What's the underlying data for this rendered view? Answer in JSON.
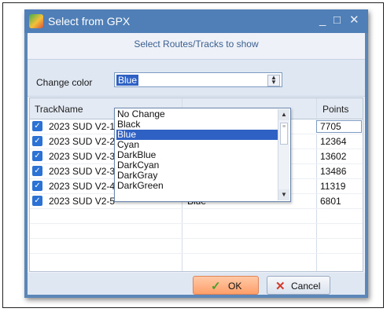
{
  "window": {
    "title": "Select from GPX",
    "controls": {
      "minimize": "_",
      "maximize": "□",
      "close": "✕"
    }
  },
  "instruction": "Select Routes/Tracks to show",
  "change_color": {
    "label": "Change color",
    "value": "Blue"
  },
  "dropdown": {
    "items": [
      "No Change",
      "Black",
      "Blue",
      "Cyan",
      "DarkBlue",
      "DarkCyan",
      "DarkGray",
      "DarkGreen"
    ],
    "selected": "Blue"
  },
  "grid": {
    "columns": {
      "name": "TrackName",
      "points": "Points"
    },
    "rows": [
      {
        "name": "2023 SUD V2-1",
        "color": "",
        "points": "7705",
        "checked": true
      },
      {
        "name": "2023 SUD V2-2",
        "color": "",
        "points": "12364",
        "checked": true
      },
      {
        "name": "2023 SUD V2-3",
        "color": "",
        "points": "13602",
        "checked": true
      },
      {
        "name": "2023 SUD V2-3",
        "color": "",
        "points": "13486",
        "checked": true
      },
      {
        "name": "2023 SUD V2-4",
        "color": "Blue",
        "points": "11319",
        "checked": true
      },
      {
        "name": "2023 SUD V2-5",
        "color": "Blue",
        "points": "6801",
        "checked": true
      }
    ]
  },
  "buttons": {
    "ok": "OK",
    "cancel": "Cancel"
  },
  "colors": {
    "titlebar": "#4f7fb6",
    "selection": "#2f61c5",
    "ok_button": "#ff9f6a",
    "checkbox": "#2b72d4"
  }
}
